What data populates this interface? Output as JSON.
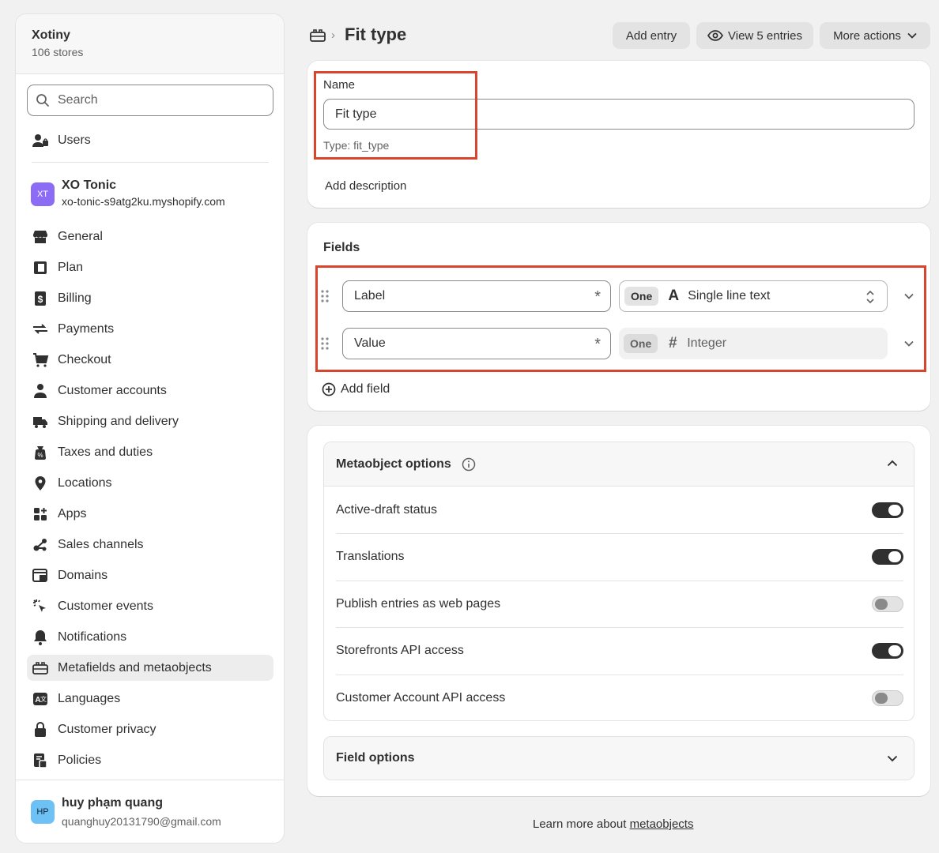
{
  "sidebar": {
    "org_name": "Xotiny",
    "org_count": "106 stores",
    "search_placeholder": "Search",
    "users_label": "Users",
    "store": {
      "initials": "XT",
      "name": "XO Tonic",
      "url": "xo-tonic-s9atg2ku.myshopify.com"
    },
    "items": [
      {
        "label": "General",
        "icon": "store-icon"
      },
      {
        "label": "Plan",
        "icon": "plan-icon"
      },
      {
        "label": "Billing",
        "icon": "billing-icon"
      },
      {
        "label": "Payments",
        "icon": "payments-icon"
      },
      {
        "label": "Checkout",
        "icon": "cart-icon"
      },
      {
        "label": "Customer accounts",
        "icon": "person-icon"
      },
      {
        "label": "Shipping and delivery",
        "icon": "truck-icon"
      },
      {
        "label": "Taxes and duties",
        "icon": "tax-bag-icon"
      },
      {
        "label": "Locations",
        "icon": "location-pin-icon"
      },
      {
        "label": "Apps",
        "icon": "apps-grid-icon"
      },
      {
        "label": "Sales channels",
        "icon": "channels-icon"
      },
      {
        "label": "Domains",
        "icon": "globe-window-icon"
      },
      {
        "label": "Customer events",
        "icon": "cursor-click-icon"
      },
      {
        "label": "Notifications",
        "icon": "bell-icon"
      },
      {
        "label": "Metafields and metaobjects",
        "icon": "metafields-icon"
      },
      {
        "label": "Languages",
        "icon": "language-icon"
      },
      {
        "label": "Customer privacy",
        "icon": "lock-icon"
      },
      {
        "label": "Policies",
        "icon": "policy-icon"
      }
    ],
    "active_item": "Metafields and metaobjects",
    "user": {
      "initials": "HP",
      "name": "huy phạm quang",
      "email": "quanghuy20131790@gmail.com"
    }
  },
  "header": {
    "title": "Fit type",
    "add_entry": "Add entry",
    "view_entries": "View 5 entries",
    "more_actions": "More actions"
  },
  "definition": {
    "name_label": "Name",
    "name_value": "Fit type",
    "type_hint": "Type: fit_type",
    "add_description": "Add description"
  },
  "fields": {
    "title": "Fields",
    "rows": [
      {
        "name": "Label",
        "count": "One",
        "type": "Single line text",
        "type_glyph": "A",
        "editable": true
      },
      {
        "name": "Value",
        "count": "One",
        "type": "Integer",
        "type_glyph": "#",
        "editable": false
      }
    ],
    "add_field": "Add field"
  },
  "metaobject_options": {
    "title": "Metaobject options",
    "options": [
      {
        "label": "Active-draft status",
        "on": true
      },
      {
        "label": "Translations",
        "on": true
      },
      {
        "label": "Publish entries as web pages",
        "on": false
      },
      {
        "label": "Storefronts API access",
        "on": true
      },
      {
        "label": "Customer Account API access",
        "on": false
      }
    ],
    "field_options": "Field options"
  },
  "footer": {
    "text": "Learn more about ",
    "link": "metaobjects"
  },
  "colors": {
    "highlight_border": "#d9442c",
    "toggle_on": "#303030",
    "store_badge": "#8c6cf5",
    "user_badge": "#6ec1f5"
  }
}
